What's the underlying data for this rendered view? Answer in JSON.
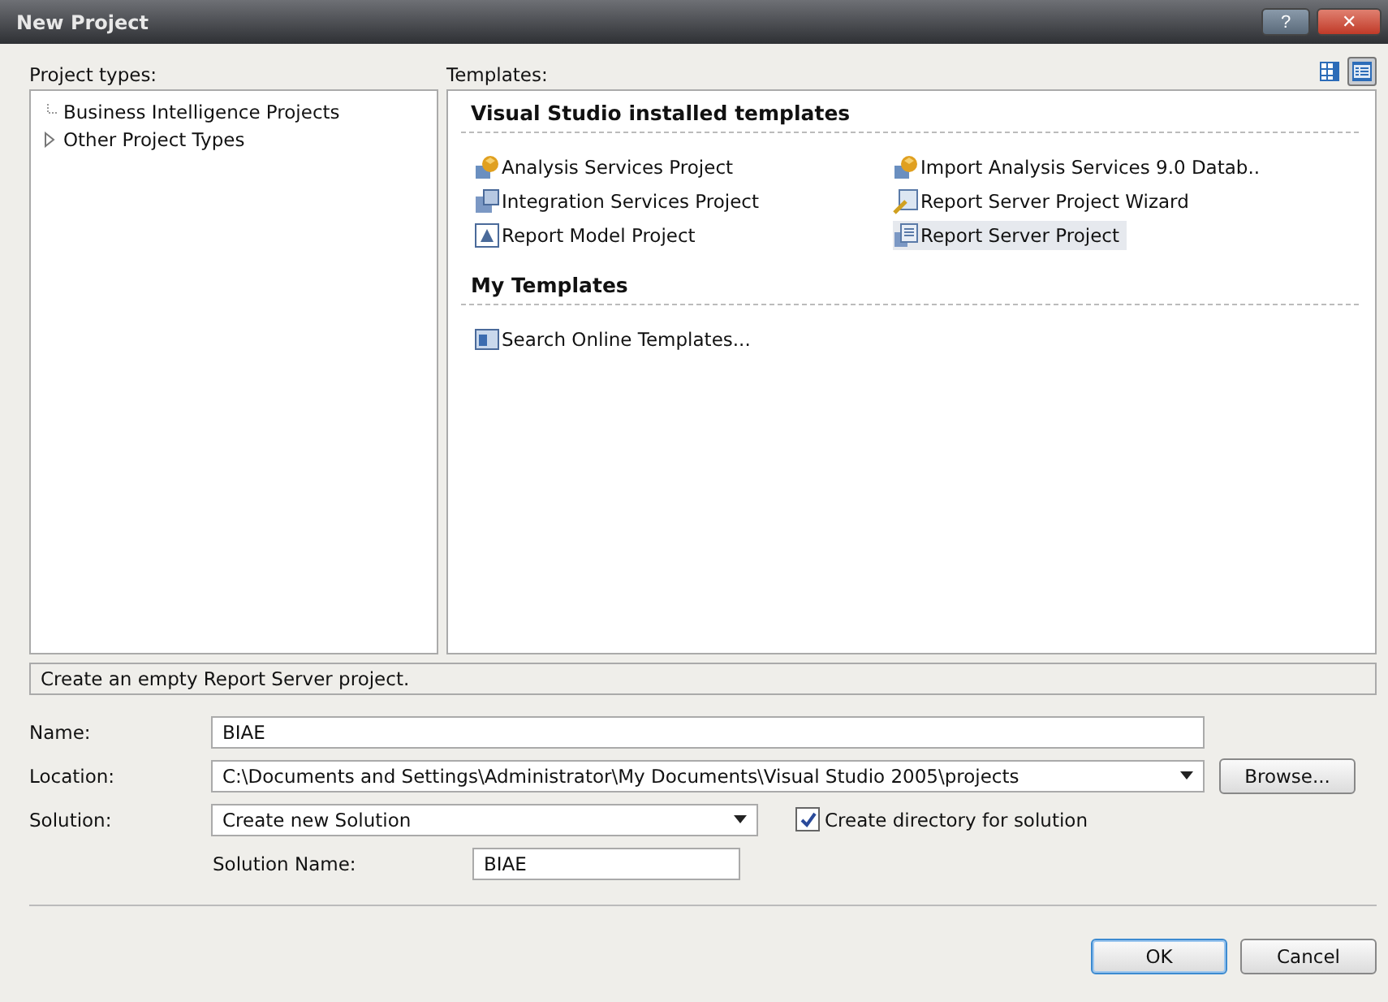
{
  "window": {
    "title": "New Project",
    "help": "?",
    "close": "✕"
  },
  "project_types": {
    "label": "Project types:",
    "items": [
      {
        "label": "Business Intelligence Projects",
        "selected": false,
        "expandable": false
      },
      {
        "label": "Other Project Types",
        "selected": false,
        "expandable": true
      }
    ]
  },
  "templates": {
    "label": "Templates:",
    "view_buttons": [
      {
        "kind": "large",
        "selected": false
      },
      {
        "kind": "small",
        "selected": true
      }
    ],
    "groups": [
      {
        "title": "Visual Studio installed templates",
        "items": [
          {
            "label": "Analysis Services Project",
            "kind": "cube",
            "selected": false
          },
          {
            "label": "Import Analysis Services 9.0 Datab..",
            "kind": "cube",
            "selected": false
          },
          {
            "label": "Integration Services Project",
            "kind": "package",
            "selected": false
          },
          {
            "label": "Report Server Project Wizard",
            "kind": "wizard",
            "selected": false
          },
          {
            "label": "Report Model Project",
            "kind": "model",
            "selected": false
          },
          {
            "label": "Report Server Project",
            "kind": "report",
            "selected": true
          }
        ]
      },
      {
        "title": "My Templates",
        "items": [
          {
            "label": "Search Online Templates...",
            "kind": "search",
            "selected": false
          }
        ]
      }
    ]
  },
  "description": "Create an empty Report Server project.",
  "form": {
    "name": {
      "label": "Name:",
      "value": "BIAE"
    },
    "location": {
      "label": "Location:",
      "value": "C:\\Documents and Settings\\Administrator\\My Documents\\Visual Studio 2005\\projects",
      "button": "Browse..."
    },
    "solution": {
      "label": "Solution:",
      "value": "Create new Solution",
      "checkbox_label": "Create directory for solution",
      "checked": true
    },
    "solution_name": {
      "label": "Solution Name:",
      "value": "BIAE"
    }
  },
  "buttons": [
    {
      "label": "OK",
      "default": true
    },
    {
      "label": "Cancel",
      "default": false
    }
  ]
}
